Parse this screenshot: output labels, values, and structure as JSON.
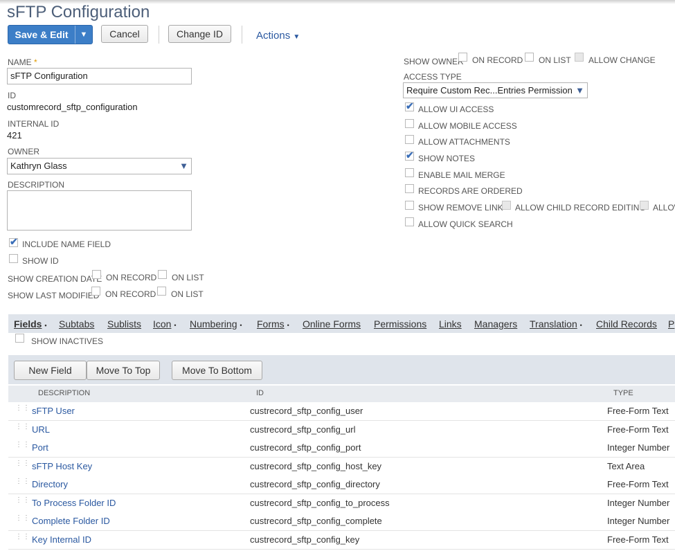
{
  "page": {
    "title": "sFTP Configuration"
  },
  "toolbar": {
    "save_edit_label": "Save & Edit",
    "cancel_label": "Cancel",
    "change_id_label": "Change ID",
    "actions_label": "Actions"
  },
  "form": {
    "name_label": "NAME",
    "name_required": "*",
    "name_value": "sFTP Configuration",
    "id_label": "ID",
    "id_value": "customrecord_sftp_configuration",
    "internal_id_label": "INTERNAL ID",
    "internal_id_value": "421",
    "owner_label": "OWNER",
    "owner_value": "Kathryn Glass",
    "description_label": "DESCRIPTION",
    "description_value": "",
    "include_name_field": {
      "label": "INCLUDE NAME FIELD",
      "checked": true
    },
    "show_id": {
      "label": "SHOW ID",
      "checked": false
    },
    "show_creation_date_label": "SHOW CREATION DATE",
    "show_last_modified_label": "SHOW LAST MODIFIED",
    "on_record_label": "ON RECORD",
    "on_list_label": "ON LIST",
    "show_owner_label": "SHOW OWNER",
    "allow_change_label": "ALLOW CHANGE",
    "access_type_label": "ACCESS TYPE",
    "access_type_value": "Require Custom Rec...Entries Permission",
    "allow_ui_access": {
      "label": "ALLOW UI ACCESS",
      "checked": true
    },
    "allow_mobile_access": {
      "label": "ALLOW MOBILE ACCESS",
      "checked": false
    },
    "allow_attachments": {
      "label": "ALLOW ATTACHMENTS",
      "checked": false
    },
    "show_notes": {
      "label": "SHOW NOTES",
      "checked": true
    },
    "enable_mail_merge": {
      "label": "ENABLE MAIL MERGE",
      "checked": false
    },
    "records_are_ordered": {
      "label": "RECORDS ARE ORDERED",
      "checked": false
    },
    "show_remove_link": {
      "label": "SHOW REMOVE LINK",
      "checked": false
    },
    "allow_child_record_editing": {
      "label": "ALLOW CHILD RECORD EDITING",
      "checked": false
    },
    "allow_truncated_label": "ALLOW",
    "allow_quick_search": {
      "label": "ALLOW QUICK SEARCH",
      "checked": false
    }
  },
  "tabs": [
    {
      "label": "Fields",
      "u": "F",
      "dot": "•",
      "active": true
    },
    {
      "label": "Subtabs",
      "u": "S",
      "dot": ""
    },
    {
      "label": "Sublists",
      "u": "u",
      "dot": ""
    },
    {
      "label": "Icon",
      "u": "I",
      "dot": "•"
    },
    {
      "label": "Numbering",
      "u": "N",
      "dot": "•"
    },
    {
      "label": "Forms",
      "u": "o",
      "dot": "•"
    },
    {
      "label": "Online Forms",
      "u": "l",
      "dot": ""
    },
    {
      "label": "Permissions",
      "u": "P",
      "dot": ""
    },
    {
      "label": "Links",
      "u": "k",
      "dot": ""
    },
    {
      "label": "Managers",
      "u": "M",
      "dot": ""
    },
    {
      "label": "Translation",
      "u": "T",
      "dot": "•"
    },
    {
      "label": "Child Records",
      "u": "C",
      "dot": ""
    },
    {
      "label": "P",
      "u": "",
      "dot": ""
    }
  ],
  "fields": {
    "show_inactives_label": "SHOW INACTIVES",
    "new_field_label": "New Field",
    "move_to_top_label": "Move To Top",
    "move_to_bottom_label": "Move To Bottom",
    "columns": [
      "DESCRIPTION",
      "ID",
      "TYPE"
    ],
    "rows": [
      {
        "description": "sFTP User",
        "id": "custrecord_sftp_config_user",
        "type": "Free-Form Text"
      },
      {
        "description": "URL",
        "id": "custrecord_sftp_config_url",
        "type": "Free-Form Text"
      },
      {
        "description": "Port",
        "id": "custrecord_sftp_config_port",
        "type": "Integer Number"
      },
      {
        "description": "sFTP Host Key",
        "id": "custrecord_sftp_config_host_key",
        "type": "Text Area"
      },
      {
        "description": "Directory",
        "id": "custrecord_sftp_config_directory",
        "type": "Free-Form Text"
      },
      {
        "description": "To Process Folder ID",
        "id": "custrecord_sftp_config_to_process",
        "type": "Integer Number"
      },
      {
        "description": "Complete Folder ID",
        "id": "custrecord_sftp_config_complete",
        "type": "Integer Number"
      },
      {
        "description": "Key Internal ID",
        "id": "custrecord_sftp_config_key",
        "type": "Free-Form Text"
      }
    ]
  },
  "colors": {
    "primary_button": "#3c7ec7",
    "link": "#2a58a0",
    "title": "#4d5f79",
    "tab_bar": "#dfe4eb"
  }
}
